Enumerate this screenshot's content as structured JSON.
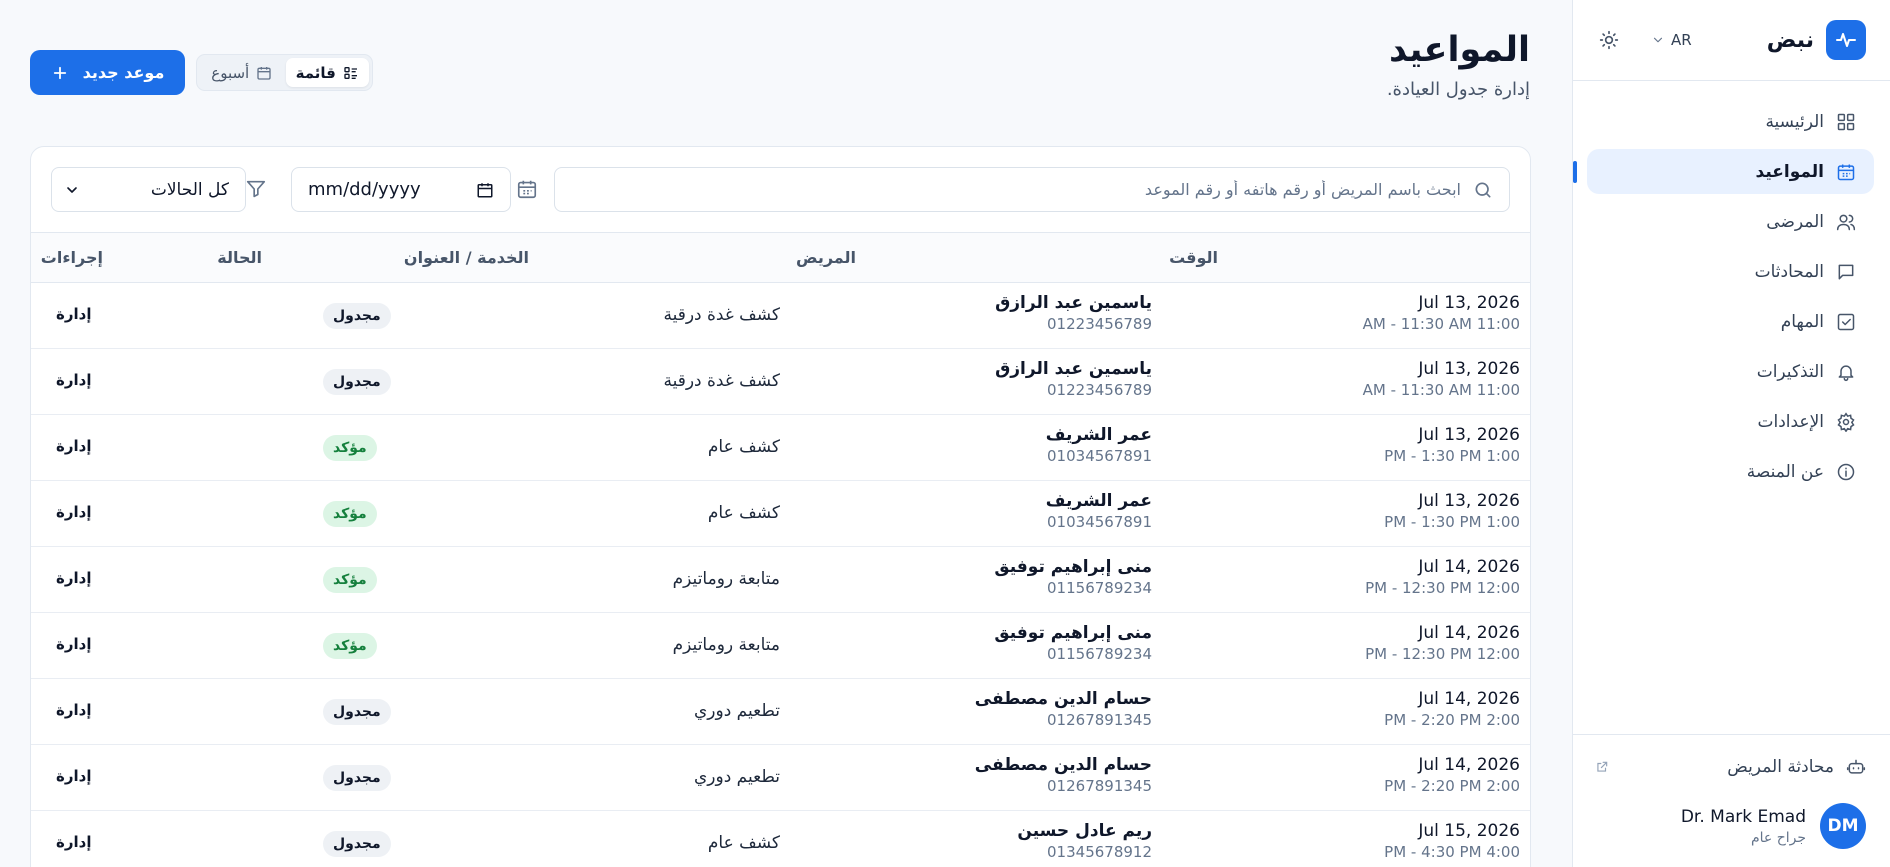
{
  "app": {
    "name": "نبض",
    "accent": "#1d6fe8"
  },
  "header_tools": {
    "language": "AR",
    "theme_icon": "sun-icon"
  },
  "sidebar": {
    "items": [
      {
        "label": "الرئيسية",
        "icon": "grid-icon",
        "active": false
      },
      {
        "label": "المواعيد",
        "icon": "calendar-icon",
        "active": true
      },
      {
        "label": "المرضى",
        "icon": "users-icon",
        "active": false
      },
      {
        "label": "المحادثات",
        "icon": "message-icon",
        "active": false
      },
      {
        "label": "المهام",
        "icon": "checkbox-icon",
        "active": false
      },
      {
        "label": "التذكيرات",
        "icon": "bell-icon",
        "active": false
      },
      {
        "label": "الإعدادات",
        "icon": "gear-icon",
        "active": false
      },
      {
        "label": "عن المنصة",
        "icon": "info-icon",
        "active": false
      }
    ],
    "footer": {
      "chat_link": "محادثة المريض",
      "user": {
        "initials": "DM",
        "name": "Dr. Mark Emad",
        "role": "جراح عام"
      }
    }
  },
  "page": {
    "title": "المواعيد",
    "subtitle": "إدارة جدول العيادة.",
    "new_button": "موعد جديد",
    "view_toggle": {
      "list": "قائمة",
      "week": "أسبوع",
      "selected": "list"
    }
  },
  "filters": {
    "search_placeholder": "ابحث باسم المريض أو رقم هاتفه أو رقم الموعد",
    "date_placeholder": "mm/dd/yyyy",
    "status_value": "كل الحالات"
  },
  "table": {
    "headers": {
      "time": "الوقت",
      "patient": "المريض",
      "service": "الخدمة / العنوان",
      "status": "الحالة",
      "actions": "إجراءات"
    },
    "status_colors": {
      "مجدول": "#eef1f5",
      "مؤكد": "#dcf5e5"
    },
    "rows": [
      {
        "date": "Jul 13, 2026",
        "time": "AM - 11:30 AM 11:00",
        "patient": "ياسمين عبد الرازق",
        "phone": "01223456789",
        "service": "كشف غدة درقية",
        "status": "مجدول",
        "status_type": "scheduled",
        "action": "إدارة"
      },
      {
        "date": "Jul 13, 2026",
        "time": "AM - 11:30 AM 11:00",
        "patient": "ياسمين عبد الرازق",
        "phone": "01223456789",
        "service": "كشف غدة درقية",
        "status": "مجدول",
        "status_type": "scheduled",
        "action": "إدارة"
      },
      {
        "date": "Jul 13, 2026",
        "time": "PM - 1:30 PM 1:00",
        "patient": "عمر الشريف",
        "phone": "01034567891",
        "service": "كشف عام",
        "status": "مؤكد",
        "status_type": "confirmed",
        "action": "إدارة"
      },
      {
        "date": "Jul 13, 2026",
        "time": "PM - 1:30 PM 1:00",
        "patient": "عمر الشريف",
        "phone": "01034567891",
        "service": "كشف عام",
        "status": "مؤكد",
        "status_type": "confirmed",
        "action": "إدارة"
      },
      {
        "date": "Jul 14, 2026",
        "time": "PM - 12:30 PM 12:00",
        "patient": "منى إبراهيم توفيق",
        "phone": "01156789234",
        "service": "متابعة روماتيزم",
        "status": "مؤكد",
        "status_type": "confirmed",
        "action": "إدارة"
      },
      {
        "date": "Jul 14, 2026",
        "time": "PM - 12:30 PM 12:00",
        "patient": "منى إبراهيم توفيق",
        "phone": "01156789234",
        "service": "متابعة روماتيزم",
        "status": "مؤكد",
        "status_type": "confirmed",
        "action": "إدارة"
      },
      {
        "date": "Jul 14, 2026",
        "time": "PM - 2:20 PM 2:00",
        "patient": "حسام الدين مصطفى",
        "phone": "01267891345",
        "service": "تطعيم دوري",
        "status": "مجدول",
        "status_type": "scheduled",
        "action": "إدارة"
      },
      {
        "date": "Jul 14, 2026",
        "time": "PM - 2:20 PM 2:00",
        "patient": "حسام الدين مصطفى",
        "phone": "01267891345",
        "service": "تطعيم دوري",
        "status": "مجدول",
        "status_type": "scheduled",
        "action": "إدارة"
      },
      {
        "date": "Jul 15, 2026",
        "time": "PM - 4:30 PM 4:00",
        "patient": "ريم عادل حسين",
        "phone": "01345678912",
        "service": "كشف عام",
        "status": "مجدول",
        "status_type": "scheduled",
        "action": "إدارة"
      }
    ]
  }
}
